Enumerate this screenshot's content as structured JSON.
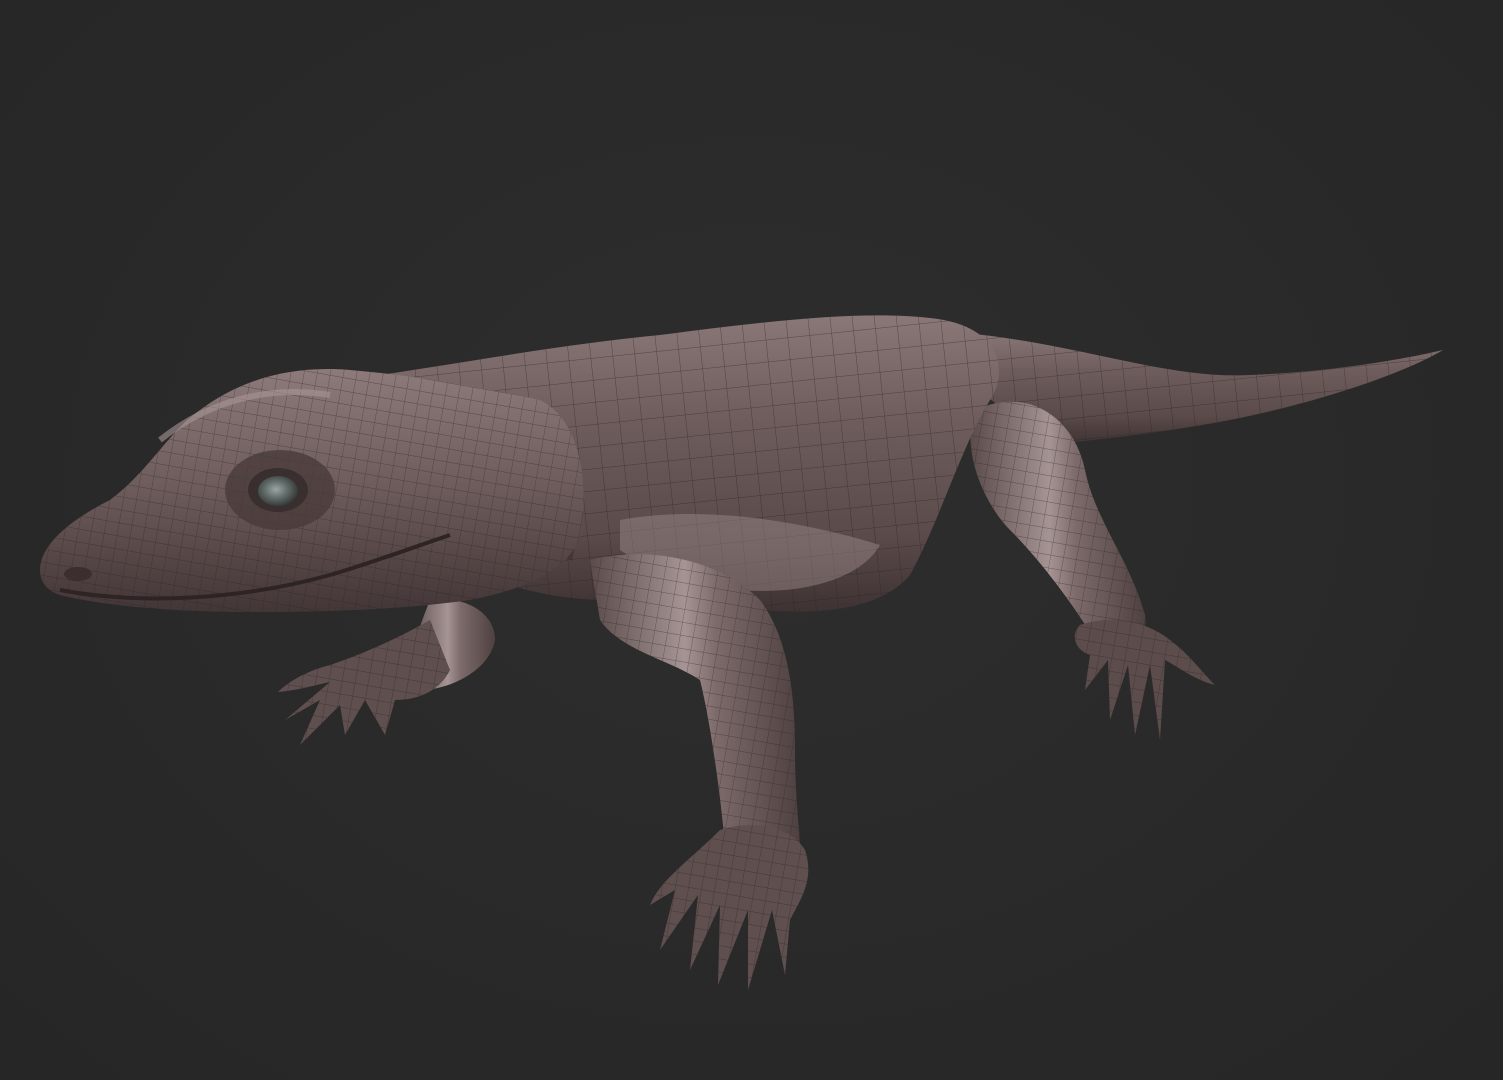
{
  "scene": {
    "background_color": "#2b2b2b",
    "subject": "lizard-3d-model",
    "render_style": "clay-wireframe",
    "material_color": "#6e5c5c",
    "highlight_color": "#b7a9a9",
    "shadow_color": "#3d3131",
    "wire_color": "#2a2020"
  }
}
